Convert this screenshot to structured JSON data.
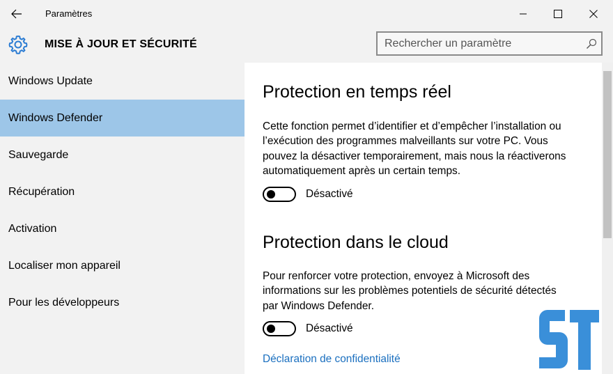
{
  "window": {
    "title": "Paramètres"
  },
  "header": {
    "section_title": "MISE À JOUR ET SÉCURITÉ",
    "search_placeholder": "Rechercher un paramètre"
  },
  "sidebar": {
    "items": [
      {
        "label": "Windows Update",
        "active": false
      },
      {
        "label": "Windows Defender",
        "active": true
      },
      {
        "label": "Sauvegarde",
        "active": false
      },
      {
        "label": "Récupération",
        "active": false
      },
      {
        "label": "Activation",
        "active": false
      },
      {
        "label": "Localiser mon appareil",
        "active": false
      },
      {
        "label": "Pour les développeurs",
        "active": false
      }
    ]
  },
  "main": {
    "realtime": {
      "title": "Protection en temps réel",
      "desc_lines": [
        "Cette fonction permet d’identifier et d’empêcher l’installation ou",
        "l’exécution des programmes malveillants sur votre PC. Vous",
        "pouvez la désactiver temporairement, mais nous la réactiverons",
        "automatiquement après un certain temps."
      ],
      "toggle_label": "Désactivé",
      "toggle_on": false
    },
    "cloud": {
      "title": "Protection dans le cloud",
      "desc_lines": [
        "Pour renforcer votre protection, envoyez à Microsoft des",
        "informations sur les problèmes potentiels de sécurité détectés",
        "par Windows Defender."
      ],
      "toggle_label": "Désactivé",
      "toggle_on": false
    },
    "privacy_link": "Déclaration de confidentialité"
  },
  "watermark": {
    "text": "ST",
    "color": "#3a8fd9"
  },
  "colors": {
    "accent": "#9dc6e8",
    "link": "#1a6fbf",
    "gear": "#2b7cd3"
  }
}
